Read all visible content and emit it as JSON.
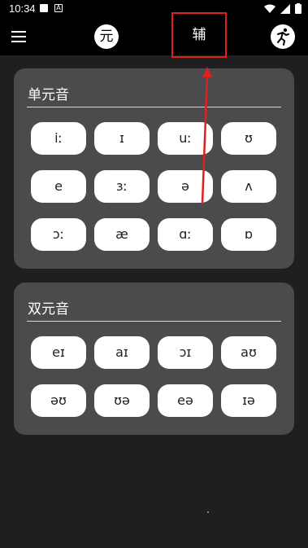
{
  "status": {
    "time": "10:34"
  },
  "appbar": {
    "tab_yuan": "元",
    "tab_fu": "辅"
  },
  "monophthongs": {
    "title": "单元音",
    "items": [
      "iː",
      "ɪ",
      "uː",
      "ʊ",
      "e",
      "ɜː",
      "ə",
      "ʌ",
      "ɔː",
      "æ",
      "ɑː",
      "ɒ"
    ]
  },
  "diphthongs": {
    "title": "双元音",
    "items": [
      "eɪ",
      "aɪ",
      "ɔɪ",
      "aʊ",
      "əʊ",
      "ʊə",
      "eə",
      "ɪə"
    ]
  },
  "colors": {
    "highlight": "#e02020",
    "card": "#4b4b4e",
    "background": "#1f1f22"
  }
}
